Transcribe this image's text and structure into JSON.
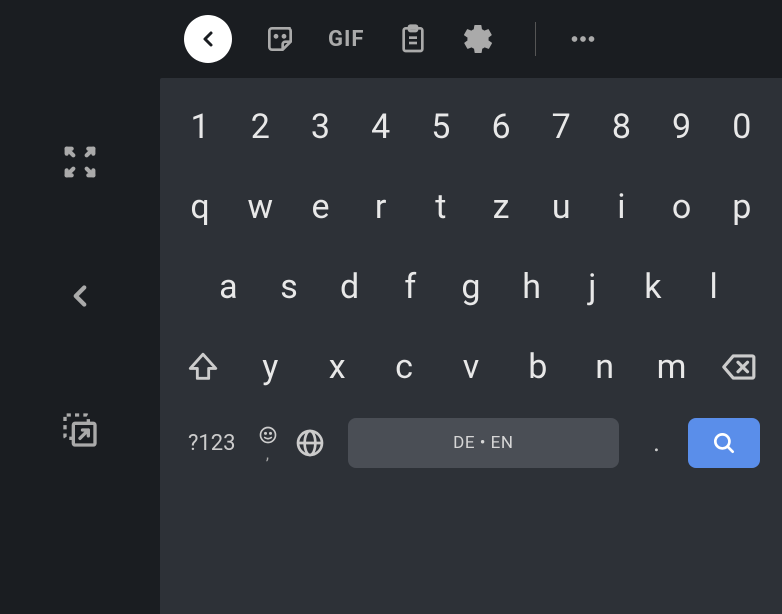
{
  "leftPanel": {
    "items": [
      "fullscreen",
      "back",
      "float"
    ]
  },
  "toolbar": {
    "gif_label": "GIF"
  },
  "keyboard": {
    "row1": [
      "1",
      "2",
      "3",
      "4",
      "5",
      "6",
      "7",
      "8",
      "9",
      "0"
    ],
    "row2": [
      "q",
      "w",
      "e",
      "r",
      "t",
      "z",
      "u",
      "i",
      "o",
      "p"
    ],
    "row3": [
      "a",
      "s",
      "d",
      "f",
      "g",
      "h",
      "j",
      "k",
      "l"
    ],
    "row4": [
      "y",
      "x",
      "c",
      "v",
      "b",
      "n",
      "m"
    ],
    "symbols_label": "?123",
    "comma": ",",
    "spacebar_label": "DE • EN",
    "period": "."
  }
}
